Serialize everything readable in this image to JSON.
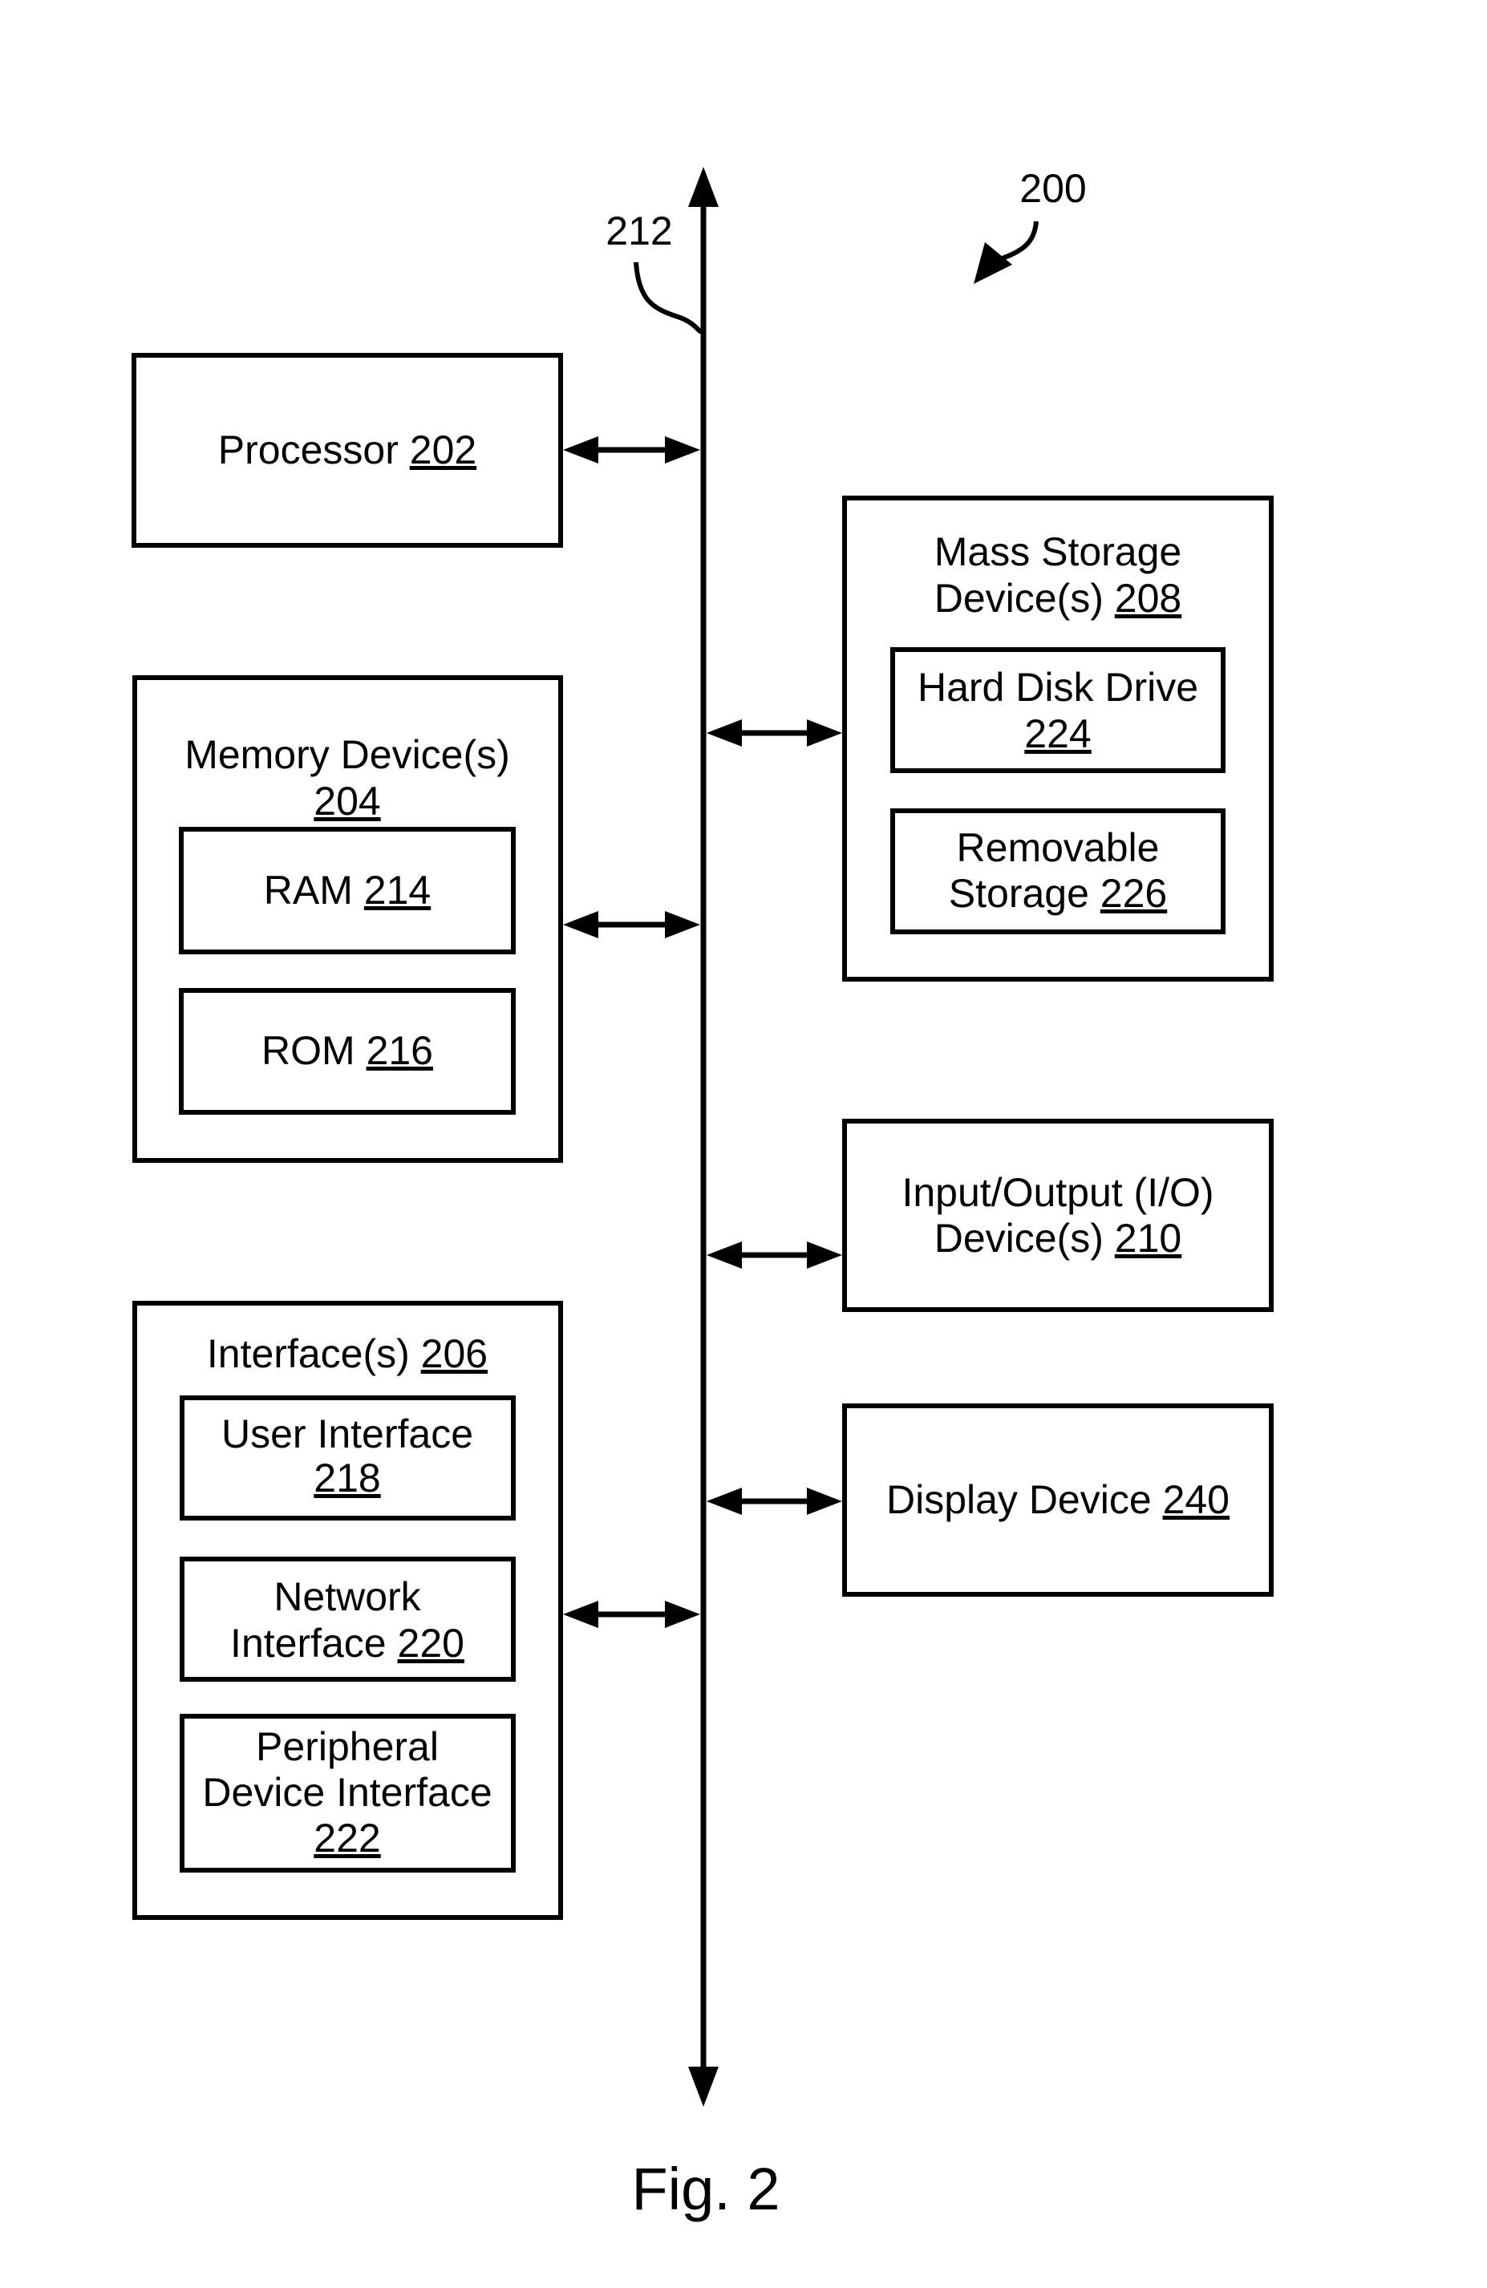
{
  "figure": {
    "caption": "Fig. 2",
    "reference_number": "200",
    "bus_label": "212"
  },
  "colors": {
    "stroke": "#000000",
    "background": "#ffffff"
  },
  "blocks": {
    "processor": {
      "name": "Processor",
      "ref": "202"
    },
    "memory": {
      "name": "Memory Device(s)",
      "ref": "204",
      "children": {
        "ram": {
          "name": "RAM",
          "ref": "214"
        },
        "rom": {
          "name": "ROM",
          "ref": "216"
        }
      }
    },
    "interfaces": {
      "name": "Interface(s)",
      "ref": "206",
      "children": {
        "user_interface": {
          "line1": "User Interface",
          "ref": "218"
        },
        "network_interface": {
          "line1": "Network",
          "line2": "Interface",
          "ref": "220"
        },
        "peripheral_interface": {
          "line1": "Peripheral",
          "line2": "Device Interface",
          "ref": "222"
        }
      }
    },
    "mass_storage": {
      "line1": "Mass Storage",
      "line2": "Device(s)",
      "ref": "208",
      "children": {
        "hard_disk": {
          "line1": "Hard Disk Drive",
          "ref": "224"
        },
        "removable": {
          "line1": "Removable",
          "line2": "Storage",
          "ref": "226"
        }
      }
    },
    "io": {
      "line1": "Input/Output (I/O)",
      "line2": "Device(s)",
      "ref": "210"
    },
    "display": {
      "name": "Display Device",
      "ref": "240"
    }
  },
  "connections": [
    {
      "from": "processor",
      "to": "bus",
      "direction": "bidirectional"
    },
    {
      "from": "memory",
      "to": "bus",
      "direction": "bidirectional"
    },
    {
      "from": "interfaces",
      "to": "bus",
      "direction": "bidirectional"
    },
    {
      "from": "mass_storage",
      "to": "bus",
      "direction": "bidirectional"
    },
    {
      "from": "io",
      "to": "bus",
      "direction": "bidirectional"
    },
    {
      "from": "display",
      "to": "bus",
      "direction": "bidirectional"
    }
  ]
}
